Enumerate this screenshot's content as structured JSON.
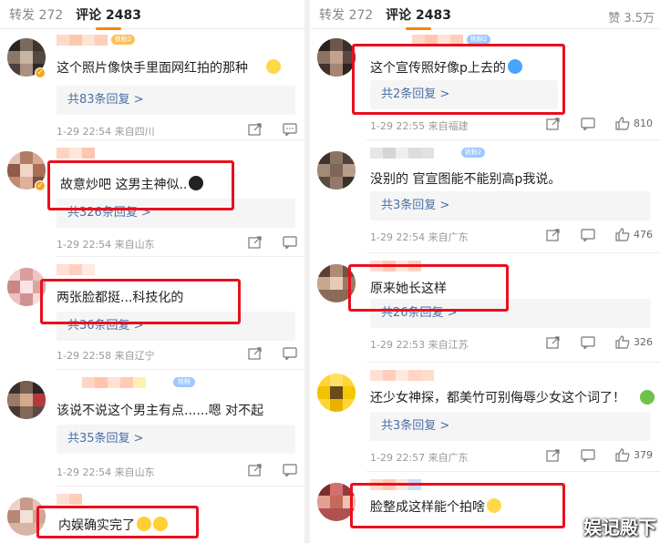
{
  "left_panel": {
    "tabs": {
      "reposts": "转发 272",
      "comments": "评论 2483"
    },
    "comments": [
      {
        "text": "这个照片像快手里面网红拍的那种",
        "replies": "共83条回复 >",
        "meta": "1-29 22:54 来自四川"
      },
      {
        "text": "故意炒吧 这男主神似..",
        "replies": "共326条回复 >",
        "meta": "1-29 22:54 来自山东"
      },
      {
        "text": "两张脸都挺...科技化的",
        "replies": "共36条回复 >",
        "meta": "1-29 22:58 来自辽宁"
      },
      {
        "text": "该说不说这个男主有点......嗯 对不起",
        "replies": "共35条回复 >",
        "meta": "1-29 22:54 来自山东"
      },
      {
        "text": "内娱确实完了"
      }
    ]
  },
  "right_panel": {
    "tabs": {
      "reposts": "转发 272",
      "comments": "评论 2483",
      "likes": "赞 3.5万"
    },
    "comments": [
      {
        "text": "这个宣传照好像p上去的",
        "replies": "共2条回复 >",
        "meta": "1-29 22:55 来自福建",
        "likes": "810"
      },
      {
        "text": "没别的 官宣图能不能别高p我说。",
        "replies": "共3条回复 >",
        "meta": "1-29 22:54 来自广东",
        "likes": "476"
      },
      {
        "text": "原来她长这样",
        "replies": "共26条回复 >",
        "meta": "1-29 22:53 来自江苏",
        "likes": "326"
      },
      {
        "text": "还少女神探，都美竹可别侮辱少女这个词了！",
        "replies": "共3条回复 >",
        "meta": "1-29 22:57 来自广东",
        "likes": "379"
      },
      {
        "text": "脸整成这样能个拍啥"
      }
    ]
  },
  "watermark": "娱记殿下",
  "colors": {
    "highlight": "#e8101e",
    "link": "#4b6fa8",
    "accent": "#ff8200"
  },
  "icons": [
    "share-icon",
    "comment-icon",
    "like-icon",
    "verified-badge-icon",
    "emoji-icon"
  ]
}
